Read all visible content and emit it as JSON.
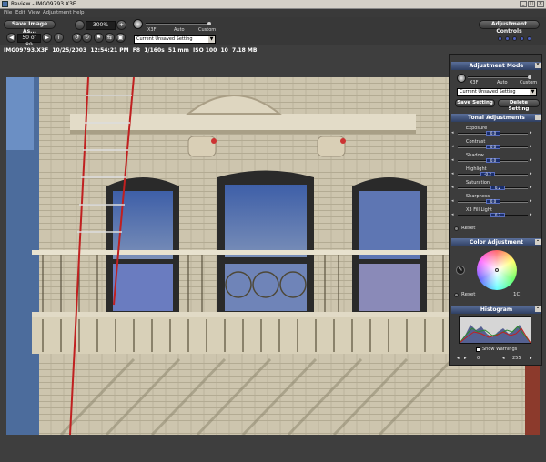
{
  "window": {
    "title": "Review - IMG09793.X3F"
  },
  "menu": [
    "File",
    "Edit",
    "View",
    "Adjustment",
    "Help"
  ],
  "toolbar": {
    "save_image_as": "Save Image As...",
    "counter": "50 of 89",
    "zoom": "300%",
    "x3f_icon_label": "X3F",
    "mode_labels": [
      "X3F",
      "Auto",
      "Custom"
    ],
    "setting_select": "Current Unsaved Setting",
    "adjustment_controls": "Adjustment Controls",
    "nav_prev": "◀",
    "nav_next": "▶",
    "zoom_out": "−",
    "zoom_in": "+"
  },
  "info": "IMG09793.X3F  10/25/2003  12:54:21 PM  F8  1/160s  51 mm  ISO 100  10  7.18 MB",
  "panel": {
    "adjustment_mode": {
      "title": "Adjustment Mode",
      "mode_labels": [
        "X3F",
        "Auto",
        "Custom"
      ],
      "select": "Current Unsaved Setting",
      "save_setting": "Save Setting",
      "delete_setting": "Delete Setting"
    },
    "tonal": {
      "title": "Tonal Adjustments",
      "sliders": [
        {
          "name": "Exposure",
          "value": "0.0"
        },
        {
          "name": "Contrast",
          "value": "0.0"
        },
        {
          "name": "Shadow",
          "value": "0.0"
        },
        {
          "name": "Highlight",
          "value": "-0.2"
        },
        {
          "name": "Saturation",
          "value": "0.2"
        },
        {
          "name": "Sharpness",
          "value": "0.0"
        },
        {
          "name": "X3 Fill Light",
          "value": "0.2"
        }
      ],
      "reset": "Reset"
    },
    "color": {
      "title": "Color Adjustment",
      "reset": "Reset",
      "value": "1C"
    },
    "histogram": {
      "title": "Histogram",
      "show_warnings": "Show Warnings",
      "low": "0",
      "high": "255"
    }
  }
}
